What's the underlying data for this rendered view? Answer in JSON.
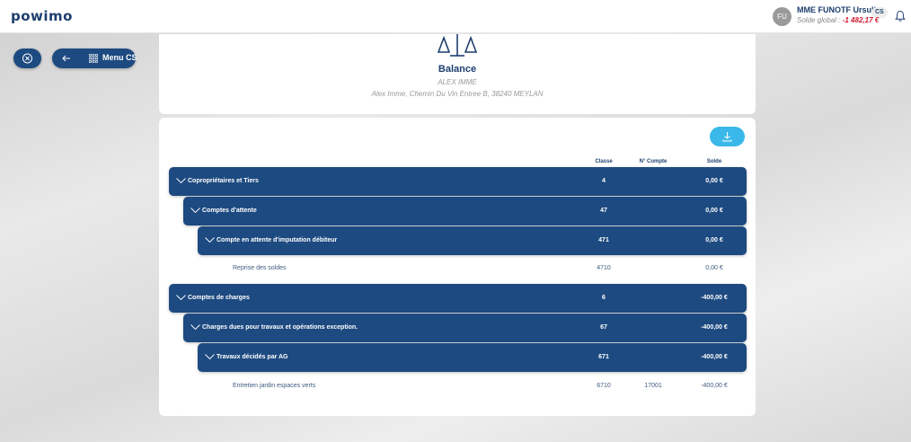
{
  "app": {
    "logo": "powimo",
    "user": {
      "initials": "FU",
      "name": "MME FUNOTF Ursuline",
      "badge": "CS",
      "solde_label": "Solde global :",
      "solde_value": "-1 482,17 €"
    }
  },
  "nav": {
    "menu_label": "Menu CS"
  },
  "header": {
    "title": "Balance",
    "subtitle": "ALEX IMME",
    "address": "Alex Imme, Chemin Du Vin Entree B, 38240 MEYLAN"
  },
  "table": {
    "columns": {
      "classe": "Classe",
      "compte": "N° Compte",
      "solde": "Solde"
    },
    "rows": [
      {
        "label": "Copropriétaires et Tiers",
        "classe": "4",
        "compte": "",
        "solde": "0,00 €"
      },
      {
        "label": "Comptes d'attente",
        "classe": "47",
        "compte": "",
        "solde": "0,00 €"
      },
      {
        "label": "Compte en attente d'imputation débiteur",
        "classe": "471",
        "compte": "",
        "solde": "0,00 €"
      },
      {
        "label": "Reprise des soldes",
        "classe": "4710",
        "compte": "",
        "solde": "0,00 €"
      },
      {
        "label": "Comptes de charges",
        "classe": "6",
        "compte": "",
        "solde": "-400,00 €"
      },
      {
        "label": "Charges dues pour travaux et opérations exception.",
        "classe": "67",
        "compte": "",
        "solde": "-400,00 €"
      },
      {
        "label": "Travaux décidés par AG",
        "classe": "671",
        "compte": "",
        "solde": "-400,00 €"
      },
      {
        "label": "Entretien jardin espaces verts",
        "classe": "6710",
        "compte": "17001",
        "solde": "-400,00 €"
      }
    ]
  },
  "colors": {
    "primary": "#1d4a80",
    "accent": "#3bb8ea",
    "negative": "#d2172e"
  }
}
